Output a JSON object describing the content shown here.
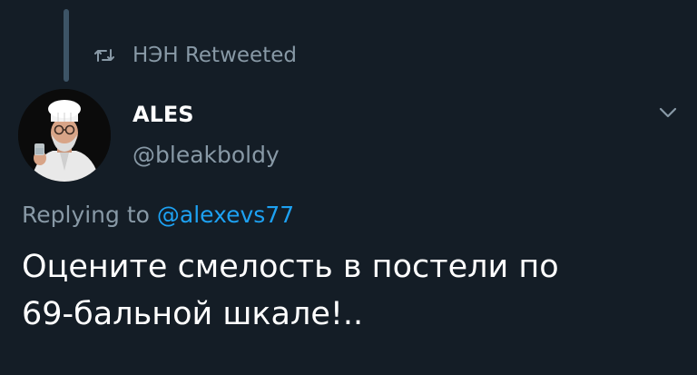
{
  "retweet": {
    "icon": "retweet-icon",
    "label": "НЭН Retweeted"
  },
  "author": {
    "name": "ALES",
    "handle": "@bleakboldy",
    "avatar": "avatar-photo"
  },
  "reply": {
    "prefix": "Replying to ",
    "mention": "@alexevs77"
  },
  "tweet": {
    "line1": "Оцените смелость в постели по",
    "line2": "69-бальной шкале!.."
  },
  "menu": {
    "icon": "chevron-down-icon"
  },
  "colors": {
    "background": "#141d26",
    "secondary_text": "#8899a6",
    "link": "#1da1f2"
  }
}
